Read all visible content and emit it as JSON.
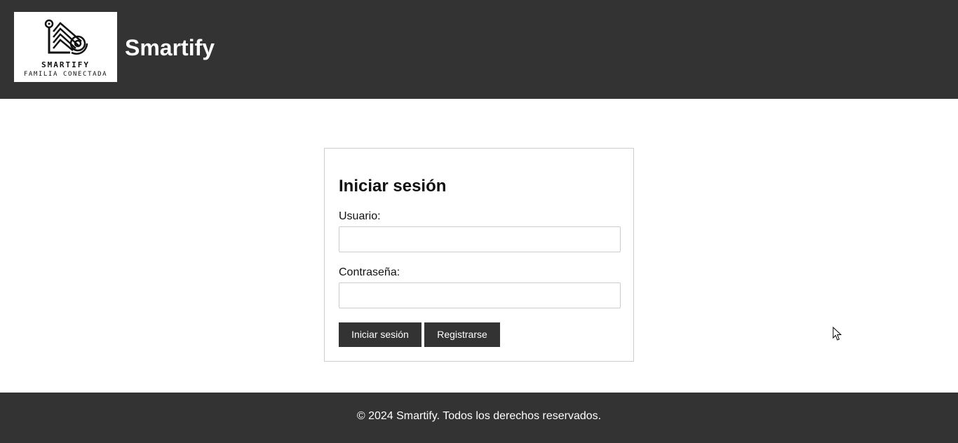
{
  "header": {
    "logo": {
      "icon": "house-circuit-logo",
      "name": "SMARTIFY",
      "tagline": "FAMILIA CONECTADA"
    },
    "site_title": "Smartify",
    "background": "#333333"
  },
  "login_form": {
    "title": "Iniciar sesión",
    "username_label": "Usuario:",
    "username_value": "",
    "password_label": "Contraseña:",
    "password_value": "",
    "login_button": "Iniciar sesión",
    "register_button": "Registrarse"
  },
  "footer": {
    "text": "© 2024 Smartify. Todos los derechos reservados."
  },
  "colors": {
    "dark": "#333333",
    "border": "#cccccc"
  },
  "cursor": {
    "icon": "mouse-pointer-icon"
  }
}
